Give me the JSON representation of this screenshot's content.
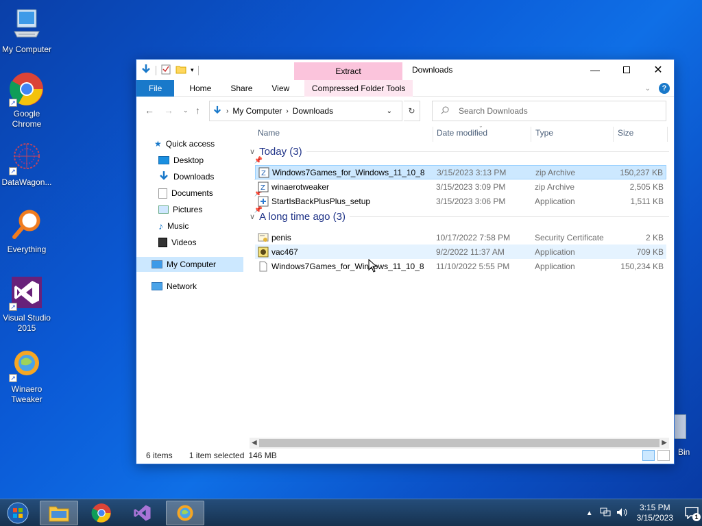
{
  "desktop": {
    "icons": [
      {
        "label": "My Computer",
        "icon": "computer-icon"
      },
      {
        "label": "Google Chrome",
        "icon": "chrome-icon"
      },
      {
        "label": "DataWagon...",
        "icon": "datawagon-icon"
      },
      {
        "label": "Everything",
        "icon": "everything-icon"
      },
      {
        "label": "Visual Studio 2015",
        "icon": "visual-studio-icon"
      },
      {
        "label": "Winaero Tweaker",
        "icon": "winaero-icon"
      }
    ],
    "recycle_bin_label": "Bin"
  },
  "window": {
    "title": "Downloads",
    "context_tab_header": "Extract",
    "tabs": {
      "file": "File",
      "home": "Home",
      "share": "Share",
      "view": "View",
      "context": "Compressed Folder Tools"
    },
    "address": {
      "parts": [
        "My Computer",
        "Downloads"
      ]
    },
    "search": {
      "placeholder": "Search Downloads"
    },
    "nav": {
      "quick_access": "Quick access",
      "items": [
        {
          "label": "Desktop",
          "pinned": true
        },
        {
          "label": "Downloads",
          "pinned": true
        },
        {
          "label": "Documents",
          "pinned": true
        },
        {
          "label": "Pictures",
          "pinned": true
        },
        {
          "label": "Music",
          "pinned": false
        },
        {
          "label": "Videos",
          "pinned": false
        }
      ],
      "my_computer": "My Computer",
      "network": "Network"
    },
    "columns": {
      "name": "Name",
      "date": "Date modified",
      "type": "Type",
      "size": "Size"
    },
    "groups": [
      {
        "title": "Today (3)",
        "files": [
          {
            "name": "Windows7Games_for_Windows_11_10_8",
            "date": "3/15/2023 3:13 PM",
            "type": "zip Archive",
            "size": "150,237 KB",
            "icon": "zip-icon",
            "state": "selected"
          },
          {
            "name": "winaerotweaker",
            "date": "3/15/2023 3:09 PM",
            "type": "zip Archive",
            "size": "2,505 KB",
            "icon": "zip-icon",
            "state": "normal"
          },
          {
            "name": "StartIsBackPlusPlus_setup",
            "date": "3/15/2023 3:06 PM",
            "type": "Application",
            "size": "1,511 KB",
            "icon": "setup-icon",
            "state": "normal"
          }
        ]
      },
      {
        "title": "A long time ago (3)",
        "files": [
          {
            "name": "penis",
            "date": "10/17/2022 7:58 PM",
            "type": "Security Certificate",
            "size": "2 KB",
            "icon": "certificate-icon",
            "state": "normal"
          },
          {
            "name": "vac467",
            "date": "9/2/2022 11:37 AM",
            "type": "Application",
            "size": "709 KB",
            "icon": "app-icon",
            "state": "hover"
          },
          {
            "name": "Windows7Games_for_Windows_11_10_8",
            "date": "11/10/2022 5:55 PM",
            "type": "Application",
            "size": "150,234 KB",
            "icon": "blank-file-icon",
            "state": "normal"
          }
        ]
      }
    ],
    "status": {
      "items": "6 items",
      "selected": "1 item selected",
      "size": "146 MB"
    }
  },
  "taskbar": {
    "time": "3:15 PM",
    "date": "3/15/2023",
    "notification_count": "1"
  }
}
